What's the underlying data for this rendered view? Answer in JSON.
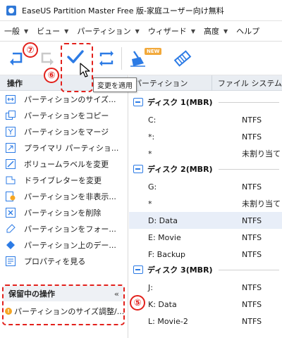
{
  "window": {
    "title": "EaseUS Partition Master Free 版-家庭ユーザー向け無料"
  },
  "menu": {
    "items": [
      {
        "label": "一般"
      },
      {
        "label": "ビュー"
      },
      {
        "label": "パーティション"
      },
      {
        "label": "ウィザード"
      },
      {
        "label": "高度"
      },
      {
        "label": "ヘルプ"
      }
    ]
  },
  "toolbar": {
    "buttons": [
      {
        "icon": "undo-icon"
      },
      {
        "icon": "redo-icon"
      },
      {
        "icon": "apply-checkmark-icon"
      },
      {
        "icon": "refresh-icon"
      },
      {
        "icon": "cleanup-broom-icon"
      },
      {
        "icon": "eraser-icon"
      }
    ],
    "new_badge": "NEW",
    "tooltip": "変更を適用"
  },
  "operations": {
    "header": "操作",
    "items": [
      {
        "label": "パーティションのサイズ...",
        "icon": "resize-icon"
      },
      {
        "label": "パーティションをコピー",
        "icon": "copy-icon"
      },
      {
        "label": "パーティションをマージ",
        "icon": "merge-icon"
      },
      {
        "label": "プライマリ パーティショ...",
        "icon": "primary-icon"
      },
      {
        "label": "ボリュームラベルを変更",
        "icon": "label-edit-icon"
      },
      {
        "label": "ドライブレターを変更",
        "icon": "drive-letter-icon"
      },
      {
        "label": "パーティションを非表示...",
        "icon": "hide-icon"
      },
      {
        "label": "パーティションを削除",
        "icon": "delete-icon"
      },
      {
        "label": "パーティションをフォー...",
        "icon": "format-icon"
      },
      {
        "label": "パーティション上のデー...",
        "icon": "wipe-icon"
      },
      {
        "label": "プロパティを見る",
        "icon": "properties-icon"
      }
    ]
  },
  "pending": {
    "header": "保留中の操作",
    "collapse_glyph": "«",
    "items": [
      {
        "label": "パーティションのサイズ調整/...",
        "icon": "warning-icon"
      }
    ]
  },
  "grid": {
    "columns": [
      "パーティション",
      "ファイル システム"
    ],
    "disks": [
      {
        "label": "ディスク 1(MBR)",
        "partitions": [
          {
            "name": "C:",
            "fs": "NTFS"
          },
          {
            "name": "*:",
            "fs": "NTFS"
          },
          {
            "name": "*",
            "fs": "未割り当て"
          }
        ]
      },
      {
        "label": "ディスク 2(MBR)",
        "partitions": [
          {
            "name": "G:",
            "fs": "NTFS"
          },
          {
            "name": "*",
            "fs": "未割り当て"
          },
          {
            "name": "D: Data",
            "fs": "NTFS",
            "selected": true
          },
          {
            "name": "E: Movie",
            "fs": "NTFS"
          },
          {
            "name": "F: Backup",
            "fs": "NTFS"
          }
        ]
      },
      {
        "label": "ディスク 3(MBR)",
        "partitions": [
          {
            "name": "J:",
            "fs": "NTFS"
          },
          {
            "name": "K: Data",
            "fs": "NTFS"
          },
          {
            "name": "L: Movie-2",
            "fs": "NTFS"
          }
        ]
      }
    ]
  },
  "annotations": {
    "step5": "⑤",
    "step6": "⑥",
    "step7": "⑦"
  },
  "colors": {
    "accent": "#2c7be5",
    "annotation": "#e2211c",
    "selected_row": "#e8eef8",
    "header_bg": "#e9edf2"
  }
}
